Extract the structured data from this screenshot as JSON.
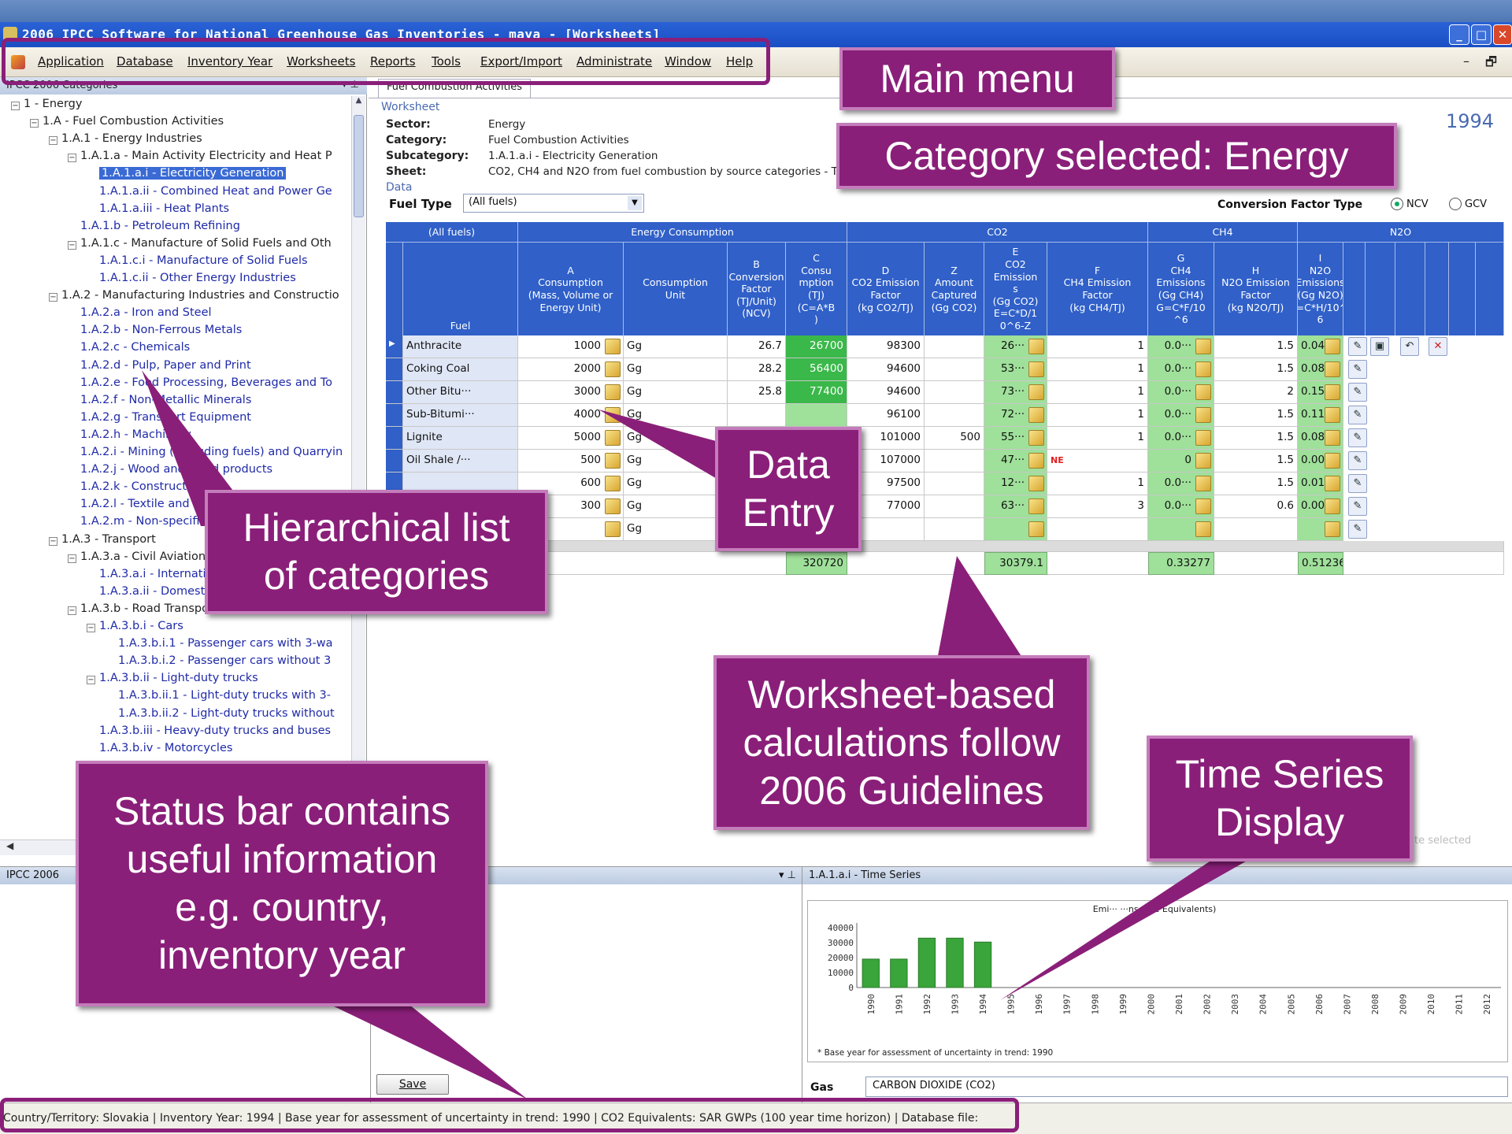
{
  "window": {
    "title": "2006 IPCC Software for National Greenhouse Gas Inventories - maya - [Worksheets]"
  },
  "menu": {
    "items": [
      "Application",
      "Database",
      "Inventory Year",
      "Worksheets",
      "Reports",
      "Tools",
      "Export/Import",
      "Administrate",
      "Window",
      "Help"
    ],
    "mdi_min": "–",
    "mdi_restore": "🗗"
  },
  "tree": {
    "header": "IPCC 2006 Categories",
    "nodes": [
      "1 - Energy",
      "1.A - Fuel Combustion Activities",
      "1.A.1 - Energy Industries",
      "1.A.1.a - Main Activity Electricity and Heat P",
      "1.A.1.a.i - Electricity Generation",
      "1.A.1.a.ii - Combined Heat and Power Ge",
      "1.A.1.a.iii - Heat Plants",
      "1.A.1.b - Petroleum Refining",
      "1.A.1.c - Manufacture of Solid Fuels and Oth",
      "1.A.1.c.i - Manufacture of Solid Fuels",
      "1.A.1.c.ii - Other Energy Industries",
      "1.A.2 - Manufacturing Industries and Constructio",
      "1.A.2.a - Iron and Steel",
      "1.A.2.b - Non-Ferrous Metals",
      "1.A.2.c - Chemicals",
      "1.A.2.d - Pulp, Paper and Print",
      "1.A.2.e - Food Processing, Beverages and To",
      "1.A.2.f - Non-Metallic Minerals",
      "1.A.2.g - Transport Equipment",
      "1.A.2.h - Machinery",
      "1.A.2.i - Mining (excluding fuels) and Quarryin",
      "1.A.2.j - Wood and wood products",
      "1.A.2.k - Construction",
      "1.A.2.l - Textile and Leather",
      "1.A.2.m - Non-specified Industry",
      "1.A.3 - Transport",
      "1.A.3.a - Civil Aviation",
      "1.A.3.a.i - International Aviation",
      "1.A.3.a.ii - Domestic Aviation",
      "1.A.3.b - Road Transportation",
      "1.A.3.b.i - Cars",
      "1.A.3.b.i.1 - Passenger cars with 3-wa",
      "1.A.3.b.i.2 - Passenger cars without 3",
      "1.A.3.b.ii - Light-duty trucks",
      "1.A.3.b.ii.1 - Light-duty trucks with 3-",
      "1.A.3.b.ii.2 - Light-duty trucks without",
      "1.A.3.b.iii - Heavy-duty trucks and buses",
      "1.A.3.b.iv - Motorcycles"
    ]
  },
  "worksheet": {
    "tab": "Fuel Combustion Activities",
    "section_label": "Worksheet",
    "sector_k": "Sector:",
    "sector_v": "Energy",
    "category_k": "Category:",
    "category_v": "Fuel Combustion Activities",
    "subcategory_k": "Subcategory:",
    "subcategory_v": "1.A.1.a.i - Electricity Generation",
    "sheet_k": "Sheet:",
    "sheet_v": "CO2, CH4 and N2O from fuel combustion by source categories - Tie",
    "data_label": "Data",
    "year": "1994",
    "fuel_type_label": "Fuel Type",
    "fuel_type_value": "(All fuels)",
    "conv_label": "Conversion Factor Type",
    "ncv": "NCV",
    "gcv": "GCV"
  },
  "grid": {
    "group_headers": [
      "(All fuels)",
      "Energy Consumption",
      "CO2",
      "CH4",
      "N2O"
    ],
    "col_headers": [
      "Fuel",
      "A\nConsumption\n(Mass, Volume or\nEnergy Unit)",
      "Consumption\nUnit",
      "B\nConversion\nFactor\n(TJ/Unit)\n(NCV)",
      "C\nConsu\nmption\n(TJ)\n(C=A*B\n)",
      "D\nCO2 Emission\nFactor\n(kg CO2/TJ)",
      "Z\nAmount\nCaptured\n(Gg CO2)",
      "E\nCO2\nEmission\ns\n(Gg CO2)\nE=C*D/1\n0^6-Z",
      "F\nCH4 Emission\nFactor\n(kg CH4/TJ)",
      "G\nCH4\nEmissions\n(Gg CH4)\nG=C*F/10\n^6",
      "H\nN2O Emission\nFactor\n(kg N2O/TJ)",
      "I\nN2O\nEmissions\n(Gg N2O)\nI=C*H/10^\n6"
    ],
    "rows": [
      {
        "fuel": "Anthracite",
        "a": "1000",
        "unit": "Gg",
        "b": "26.7",
        "c": "26700",
        "d": "98300",
        "z": "",
        "e": "26···",
        "f": "1",
        "g": "0.0···",
        "h": "1.5",
        "i": "0.04···"
      },
      {
        "fuel": "Coking Coal",
        "a": "2000",
        "unit": "Gg",
        "b": "28.2",
        "c": "56400",
        "d": "94600",
        "z": "",
        "e": "53···",
        "f": "1",
        "g": "0.0···",
        "h": "1.5",
        "i": "0.0846"
      },
      {
        "fuel": "Other Bitu···",
        "a": "3000",
        "unit": "Gg",
        "b": "25.8",
        "c": "77400",
        "d": "94600",
        "z": "",
        "e": "73···",
        "f": "1",
        "g": "0.0···",
        "h": "2",
        "i": "0.1548"
      },
      {
        "fuel": "Sub-Bitumi···",
        "a": "4000",
        "unit": "Gg",
        "b": "",
        "c": "",
        "d": "96100",
        "z": "",
        "e": "72···",
        "f": "1",
        "g": "0.0···",
        "h": "1.5",
        "i": "0.1134"
      },
      {
        "fuel": "Lignite",
        "a": "5000",
        "unit": "Gg",
        "b": "",
        "c": "",
        "d": "101000",
        "z": "500",
        "e": "55···",
        "f": "1",
        "g": "0.0···",
        "h": "1.5",
        "i": "0.08···"
      },
      {
        "fuel": "Oil Shale /···",
        "a": "500",
        "unit": "Gg",
        "b": "",
        "c": "",
        "d": "107000",
        "z": "",
        "e": "47···",
        "f": "NE",
        "g": "0",
        "h": "1.5",
        "i": "0.00···"
      },
      {
        "fuel": "",
        "a": "600",
        "unit": "Gg",
        "b": "",
        "c": "",
        "d": "97500",
        "z": "",
        "e": "12···",
        "f": "1",
        "g": "0.0···",
        "h": "1.5",
        "i": "0.01···"
      },
      {
        "fuel": "",
        "a": "300",
        "unit": "Gg",
        "b": "",
        "c": "",
        "d": "77000",
        "z": "",
        "e": "63···",
        "f": "3",
        "g": "0.0···",
        "h": "0.6",
        "i": "0.00···"
      },
      {
        "fuel": "",
        "a": "",
        "unit": "Gg",
        "b": "",
        "c": "",
        "d": "",
        "z": "",
        "e": "",
        "f": "",
        "g": "",
        "h": "",
        "i": ""
      }
    ],
    "totals": {
      "c": "320720",
      "e": "30379.1",
      "g": "0.33277",
      "i": "0.51236"
    }
  },
  "bottom": {
    "left_header": "IPCC 2006",
    "save_label": "Save",
    "ts_header": "1.A.1.a.i - Time Series",
    "not_selected": "te selected",
    "gas_label": "Gas",
    "gas_value": "CARBON DIOXIDE (CO2)"
  },
  "chart_data": {
    "type": "bar",
    "title": "Emi··· ···ns CO2 Equivalents)",
    "categories": [
      "1990",
      "1991",
      "1992",
      "1993",
      "1994",
      "1995",
      "1996",
      "1997",
      "1998",
      "1999",
      "2000",
      "2001",
      "2002",
      "2003",
      "2004",
      "2005",
      "2006",
      "2007",
      "2008",
      "2009",
      "2010",
      "2011",
      "2012"
    ],
    "values": [
      19000,
      19000,
      33000,
      33000,
      30379,
      null,
      null,
      null,
      null,
      null,
      null,
      null,
      null,
      null,
      null,
      null,
      null,
      null,
      null,
      null,
      null,
      null,
      null
    ],
    "ytick_labels": [
      "0",
      "10000",
      "20000",
      "30000",
      "40000"
    ],
    "ylim": [
      0,
      40000
    ],
    "footnote": "* Base year for assessment of uncertainty in trend: 1990",
    "bar_color": "#3aa53a"
  },
  "statusbar": {
    "text": "Country/Territory:  Slovakia | Inventory Year:  1994 | Base year for assessment of uncertainty in trend:  1990 | CO2 Equivalents:  SAR GWPs (100 year time horizon) | Database file:"
  },
  "callouts": {
    "main_menu": "Main menu",
    "category": "Category selected: Energy",
    "data_entry": "Data\nEntry",
    "hierarchical": "Hierarchical list\nof categories",
    "worksheet_calc": "Worksheet-based\ncalculations follow\n2006 Guidelines",
    "time_series": "Time Series\nDisplay",
    "status_bar": "Status bar contains\nuseful information\ne.g. country,\ninventory year",
    "color": "#8a1f79"
  }
}
